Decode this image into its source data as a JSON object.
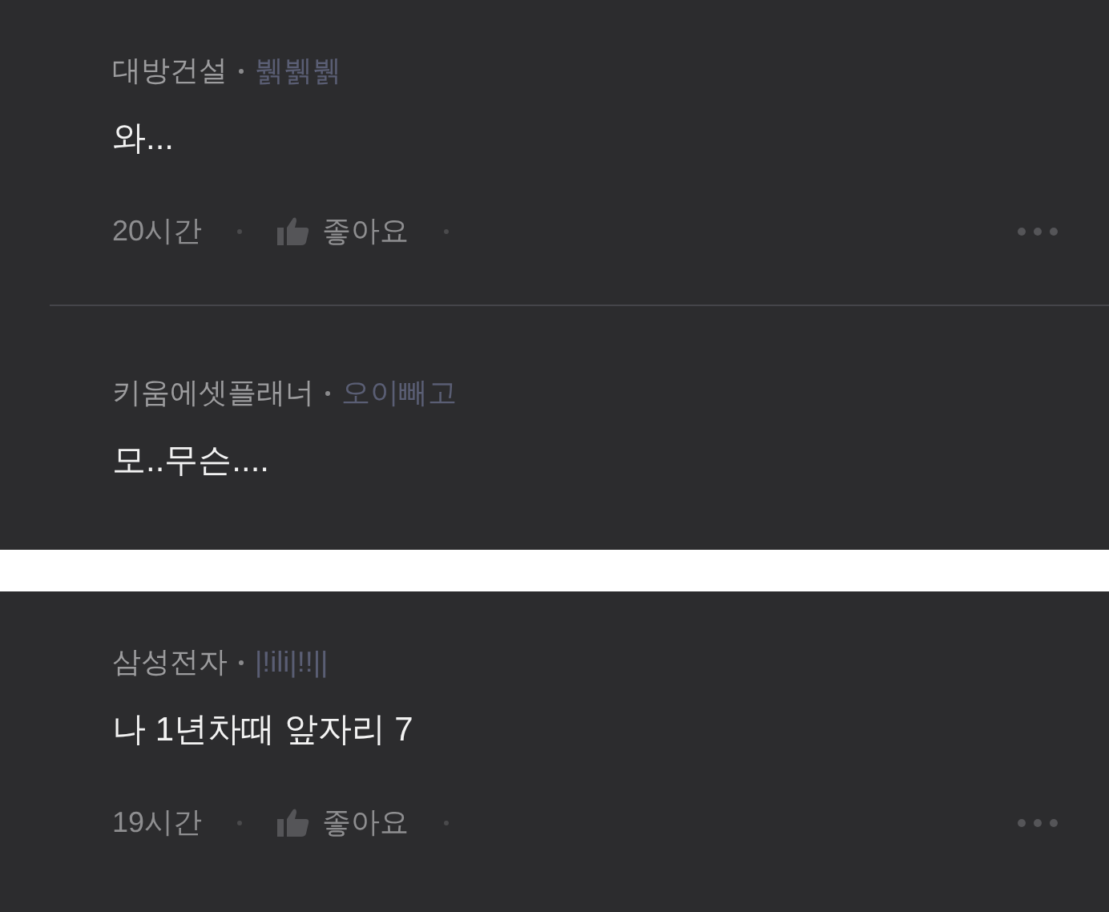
{
  "panels": [
    {
      "comments": [
        {
          "company": "대방건설",
          "nickname": "뷁뷁뷁",
          "text": "와...",
          "time": "20시간",
          "like_label": "좋아요"
        },
        {
          "company": "키움에셋플래너",
          "nickname": "오이빼고",
          "text": "모..무슨...."
        }
      ]
    },
    {
      "comments": [
        {
          "company": "삼성전자",
          "nickname": "|!ili|!!||",
          "text": "나 1년차때 앞자리 7",
          "time": "19시간",
          "like_label": "좋아요"
        }
      ]
    }
  ]
}
